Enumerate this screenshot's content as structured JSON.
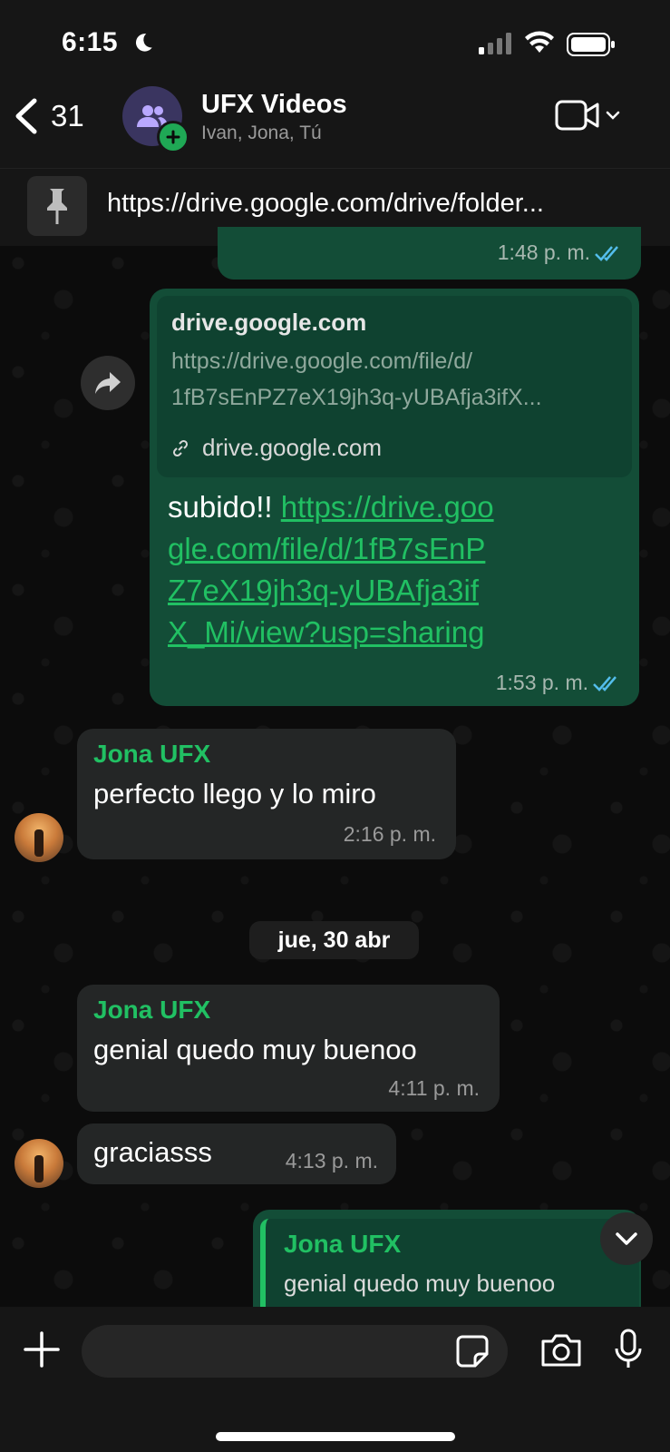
{
  "status_bar": {
    "time": "6:15"
  },
  "header": {
    "back_count": "31",
    "title": "UFX Videos",
    "subtitle": "Ivan, Jona, Tú"
  },
  "pinned": {
    "text": "https://drive.google.com/drive/folder..."
  },
  "messages": [
    {
      "type": "outgoing",
      "time": "1:48 p. m."
    },
    {
      "type": "outgoing",
      "preview_domain": "drive.google.com",
      "preview_url_line1": "https://drive.google.com/file/d/",
      "preview_url_line2": "1fB7sEnPZ7eX19jh3q-yUBAfja3ifX...",
      "preview_link_label": "drive.google.com",
      "text_prefix": "subido!! ",
      "link_text": "https://drive.google.com/file/d/1fB7sEnPZ7eX19jh3q-yUBAfja3ifX_Mi/view?usp=sharing",
      "time": "1:53 p. m."
    },
    {
      "type": "incoming",
      "sender": "Jona UFX",
      "text": "perfecto llego y lo miro",
      "time": "2:16 p. m."
    },
    {
      "type": "incoming",
      "sender": "Jona UFX",
      "text": "genial quedo muy buenoo",
      "time": "4:11 p. m."
    },
    {
      "type": "incoming",
      "text": "graciasss",
      "time": "4:13 p. m."
    },
    {
      "type": "outgoing",
      "quote_sender": "Jona UFX",
      "quote_text": "genial quedo muy buenoo"
    }
  ],
  "date_divider": "jue, 30 abr",
  "composer": {
    "placeholder": ""
  },
  "colors": {
    "accent": "#21c063",
    "outgoing_bubble": "#134d37",
    "incoming_bubble": "#242626",
    "tick_blue": "#53bdeb"
  }
}
